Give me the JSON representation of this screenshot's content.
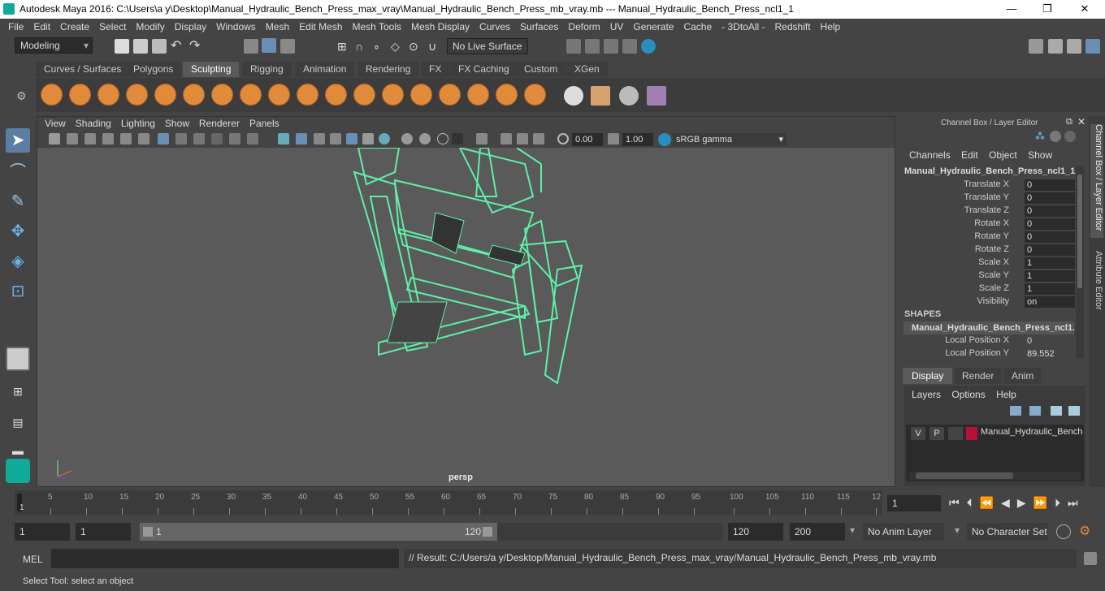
{
  "window": {
    "title": "Autodesk Maya 2016: C:\\Users\\a y\\Desktop\\Manual_Hydraulic_Bench_Press_max_vray\\Manual_Hydraulic_Bench_Press_mb_vray.mb   ---   Manual_Hydraulic_Bench_Press_ncl1_1",
    "minimize": "—",
    "maximize": "❐",
    "close": "✕"
  },
  "menubar": [
    "File",
    "Edit",
    "Create",
    "Select",
    "Modify",
    "Display",
    "Windows",
    "Mesh",
    "Edit Mesh",
    "Mesh Tools",
    "Mesh Display",
    "Curves",
    "Surfaces",
    "Deform",
    "UV",
    "Generate",
    "Cache",
    "- 3DtoAll -",
    "Redshift",
    "Help"
  ],
  "statusline": {
    "mode": "Modeling",
    "live_surface": "No Live Surface"
  },
  "shelf_tabs": [
    "Curves / Surfaces",
    "Polygons",
    "Sculpting",
    "Rigging",
    "Animation",
    "Rendering",
    "FX",
    "FX Caching",
    "Custom",
    "XGen"
  ],
  "shelf_active": "Sculpting",
  "viewport": {
    "menu": [
      "View",
      "Shading",
      "Lighting",
      "Show",
      "Renderer",
      "Panels"
    ],
    "exposure": "0.00",
    "gamma": "1.00",
    "color_space": "sRGB gamma",
    "camera_label": "persp"
  },
  "channel_box": {
    "header": "Channel Box / Layer Editor",
    "menu": [
      "Channels",
      "Edit",
      "Object",
      "Show"
    ],
    "object_name": "Manual_Hydraulic_Bench_Press_ncl1_1",
    "attributes": [
      {
        "label": "Translate X",
        "value": "0"
      },
      {
        "label": "Translate Y",
        "value": "0"
      },
      {
        "label": "Translate Z",
        "value": "0"
      },
      {
        "label": "Rotate X",
        "value": "0"
      },
      {
        "label": "Rotate Y",
        "value": "0"
      },
      {
        "label": "Rotate Z",
        "value": "0"
      },
      {
        "label": "Scale X",
        "value": "1"
      },
      {
        "label": "Scale Y",
        "value": "1"
      },
      {
        "label": "Scale Z",
        "value": "1"
      },
      {
        "label": "Visibility",
        "value": "on"
      }
    ],
    "shapes_label": "SHAPES",
    "shape_name": "Manual_Hydraulic_Bench_Press_ncl1...",
    "shape_attributes": [
      {
        "label": "Local Position X",
        "value": "0"
      },
      {
        "label": "Local Position Y",
        "value": "89.552"
      }
    ]
  },
  "layer_editor": {
    "tabs": [
      "Display",
      "Render",
      "Anim"
    ],
    "active_tab": "Display",
    "menu": [
      "Layers",
      "Options",
      "Help"
    ],
    "layer": {
      "v": "V",
      "p": "P",
      "name": "Manual_Hydraulic_Bench",
      "color": "#b5123a"
    }
  },
  "side_tabs": [
    "Channel Box / Layer Editor",
    "Attribute Editor"
  ],
  "timeline": {
    "ticks": [
      "5",
      "10",
      "15",
      "20",
      "25",
      "30",
      "35",
      "40",
      "45",
      "50",
      "55",
      "60",
      "65",
      "70",
      "75",
      "80",
      "85",
      "90",
      "95",
      "100",
      "105",
      "110",
      "115",
      "12"
    ],
    "start_marker": "1",
    "current_frame": "1"
  },
  "range": {
    "start": "1",
    "anim_start": "1",
    "slider_start": "1",
    "slider_end": "120",
    "end": "120",
    "anim_end": "200",
    "anim_layer": "No Anim Layer",
    "character_set": "No Character Set"
  },
  "mel": {
    "label": "MEL",
    "result": "// Result: C:/Users/a y/Desktop/Manual_Hydraulic_Bench_Press_max_vray/Manual_Hydraulic_Bench_Press_mb_vray.mb"
  },
  "help_line": "Select Tool: select an object"
}
